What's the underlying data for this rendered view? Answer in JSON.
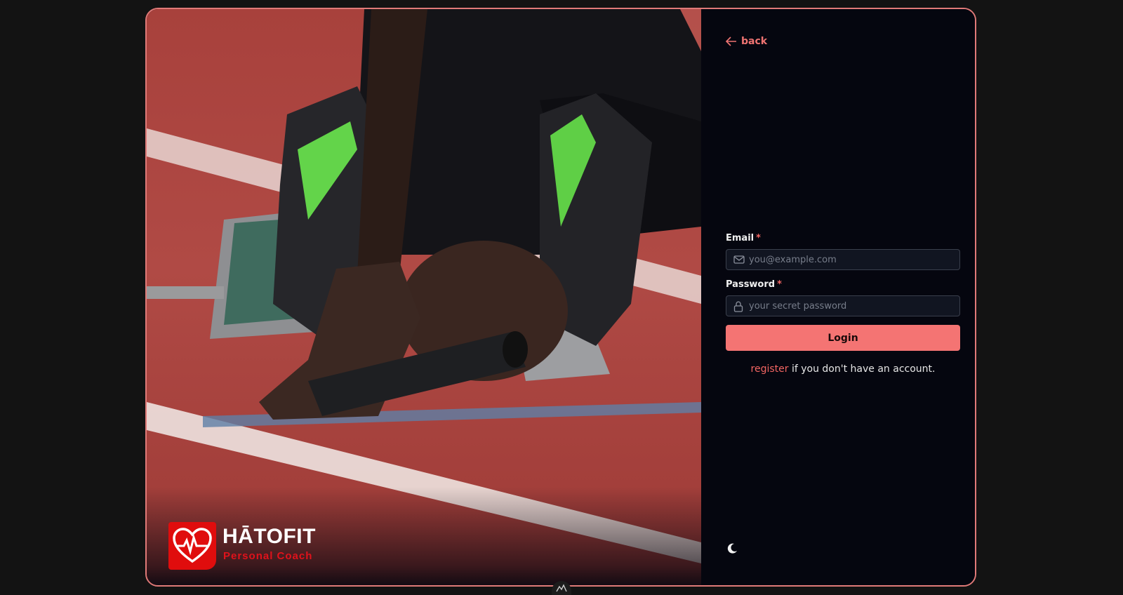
{
  "nav": {
    "back_label": "back"
  },
  "brand": {
    "name": "HĀTOFIT",
    "tagline": "Personal Coach",
    "color": "#e00d0d"
  },
  "form": {
    "email": {
      "label": "Email",
      "required_mark": "*",
      "placeholder": "you@example.com",
      "value": ""
    },
    "password": {
      "label": "Password",
      "required_mark": "*",
      "placeholder": "your secret password",
      "value": ""
    },
    "submit_label": "Login",
    "register_link": "register",
    "register_suffix": " if you don't have an account."
  },
  "theme": {
    "icon": "moon-icon"
  },
  "colors": {
    "accent": "#f47473",
    "border": "#e07a78",
    "panel_bg": "#05060f"
  }
}
